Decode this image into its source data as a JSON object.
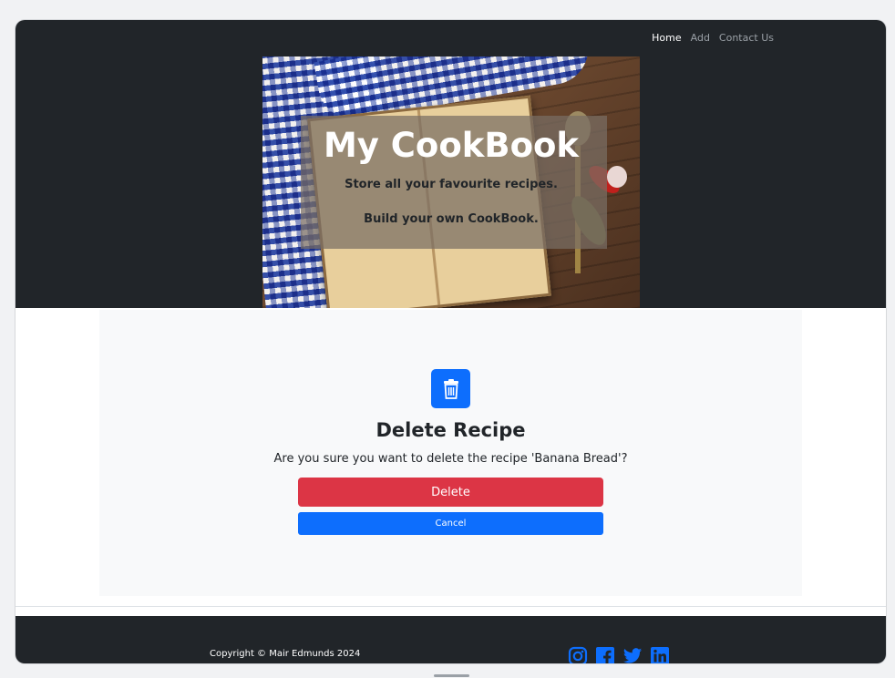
{
  "nav": {
    "items": [
      {
        "label": "Home",
        "active": true
      },
      {
        "label": "Add",
        "active": false
      },
      {
        "label": "Contact Us",
        "active": false
      }
    ]
  },
  "hero": {
    "title": "My CookBook",
    "subtitle1": "Store all your favourite recipes.",
    "subtitle2": "Build your own CookBook."
  },
  "delete_dialog": {
    "icon": "trash-icon",
    "title": "Delete Recipe",
    "message": "Are you sure you want to delete the recipe 'Banana Bread'?",
    "delete_label": "Delete",
    "cancel_label": "Cancel"
  },
  "footer": {
    "copyright": "Copyright © Mair Edmunds 2024",
    "social_icons": [
      "instagram-icon",
      "facebook-icon",
      "twitter-icon",
      "linkedin-icon"
    ]
  },
  "colors": {
    "header_bg": "#212529",
    "primary": "#0d6efd",
    "danger": "#dc3545",
    "panel_bg": "#f8f9fa"
  }
}
